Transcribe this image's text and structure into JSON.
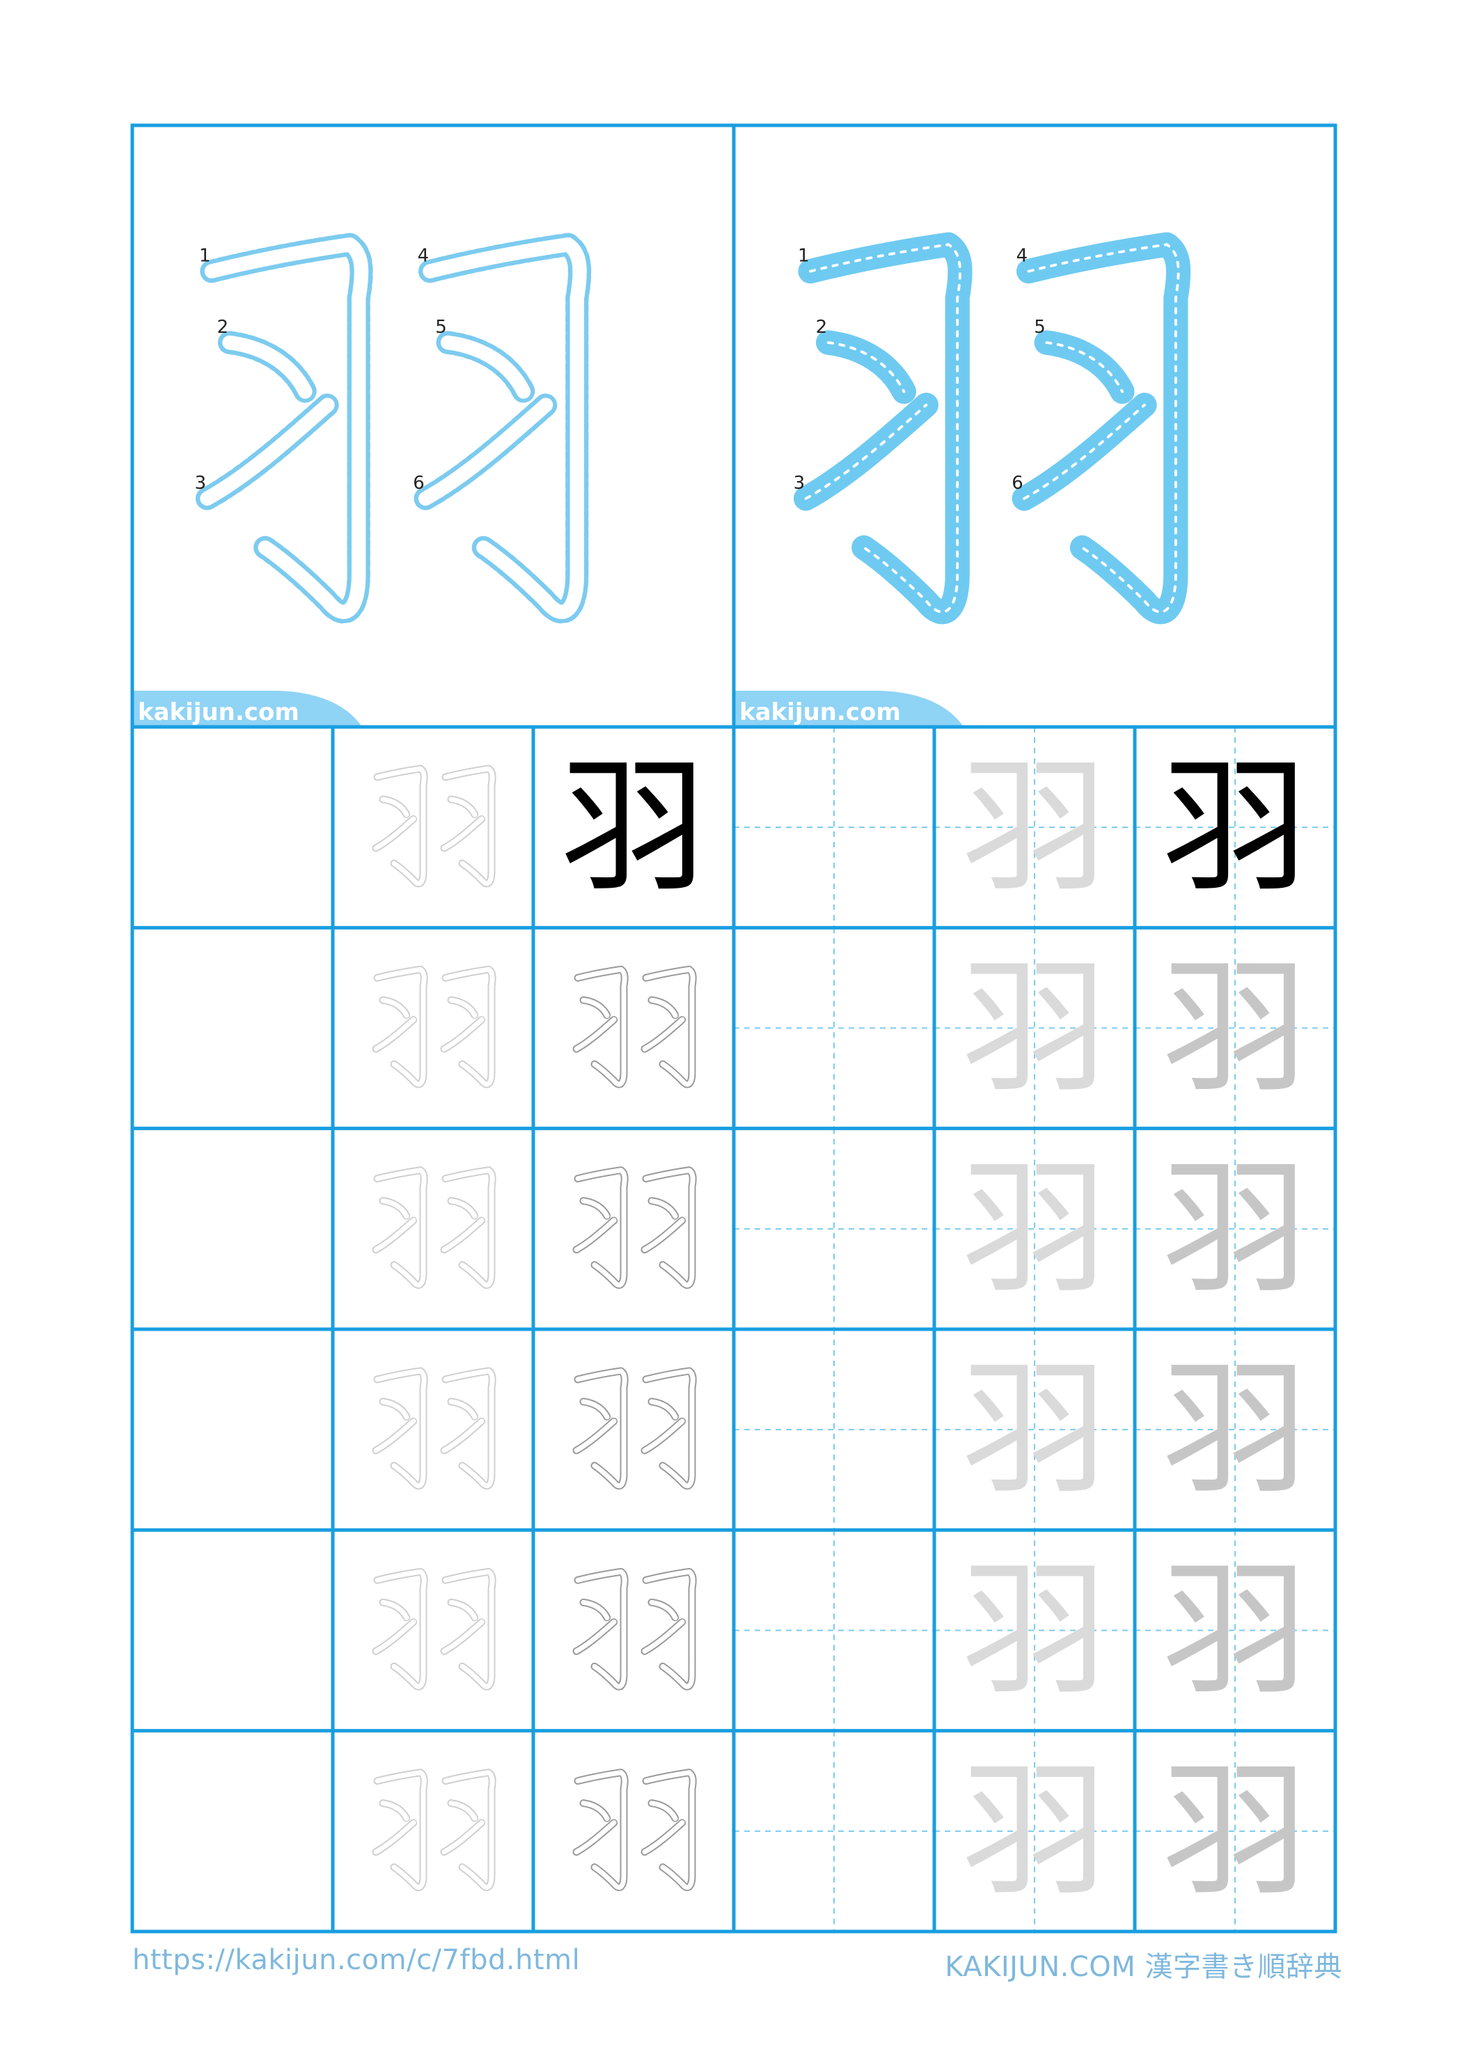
{
  "character": "羽",
  "watermark": "kakijun.com",
  "stroke_numbers": [
    "1",
    "2",
    "3",
    "4",
    "5",
    "6"
  ],
  "footer": {
    "url": "https://kakijun.com/c/7fbd.html",
    "brand": "KAKIJUN.COM 漢字書き順辞典"
  },
  "colors": {
    "grid": "#1a9ee0",
    "guide": "#7ccbef",
    "stroke_fill": "#6fcaf1",
    "trace_dark": "#9a9a9a",
    "trace_light": "#cfcfcf",
    "gray_char": "#dadada",
    "gray_char_dark": "#c6c6c6",
    "model_char": "#000000",
    "footer_text": "#7fb8dd"
  }
}
